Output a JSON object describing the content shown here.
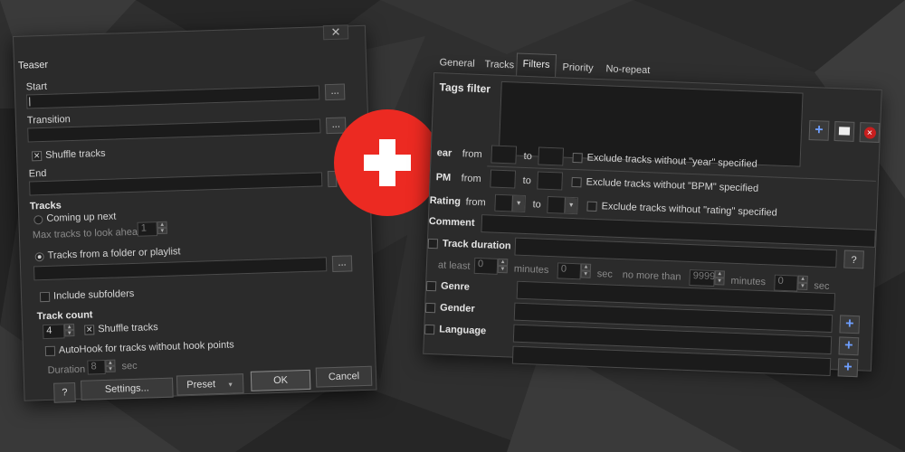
{
  "colors": {
    "accent_red": "#ec2a22",
    "plus_blue": "#6e9fff"
  },
  "teaser": {
    "title": "Teaser",
    "close_icon": "close-icon",
    "start_label": "Start",
    "transition_label": "Transition",
    "browse": "...",
    "shuffle_tracks_label": "Shuffle tracks",
    "shuffle_tracks_checked": true,
    "end_label": "End",
    "tracks_section": "Tracks",
    "coming_up_next": "Coming up next",
    "max_tracks_label": "Max tracks to look ahead",
    "max_tracks_value": "1",
    "tracks_from_folder": "Tracks from a folder or playlist",
    "include_subfolders": "Include subfolders",
    "track_count_section": "Track count",
    "track_count_value": "4",
    "shuffle_tracks_2": "Shuffle tracks",
    "autohook": "AutoHook for tracks without hook points",
    "duration_label": "Duration",
    "duration_value": "8",
    "duration_unit": "sec",
    "help": "?",
    "settings": "Settings...",
    "preset": "Preset",
    "ok": "OK",
    "cancel": "Cancel"
  },
  "filters": {
    "tabs": [
      "General",
      "Tracks",
      "Filters",
      "Priority",
      "No-repeat"
    ],
    "active_tab": "Filters",
    "tags_filter": "Tags filter",
    "year_label": "ear",
    "bpm_label": "PM",
    "rating_label": "Rating",
    "from": "from",
    "to": "to",
    "exclude_year": "Exclude tracks without \"year\" specified",
    "exclude_bpm": "Exclude tracks without \"BPM\" specified",
    "exclude_rating": "Exclude tracks without \"rating\" specified",
    "comment": "Comment",
    "track_duration": "Track duration",
    "at_least": "at least",
    "minutes": "minutes",
    "sec": "sec",
    "no_more_than": "no more than",
    "min_minutes": "0",
    "min_sec": "0",
    "max_minutes": "9999",
    "max_sec": "0",
    "help": "?",
    "genre": "Genre",
    "gender": "Gender",
    "language": "Language",
    "add_icon": "plus-icon",
    "folder_icon": "folder-icon",
    "delete_icon": "delete-icon"
  }
}
